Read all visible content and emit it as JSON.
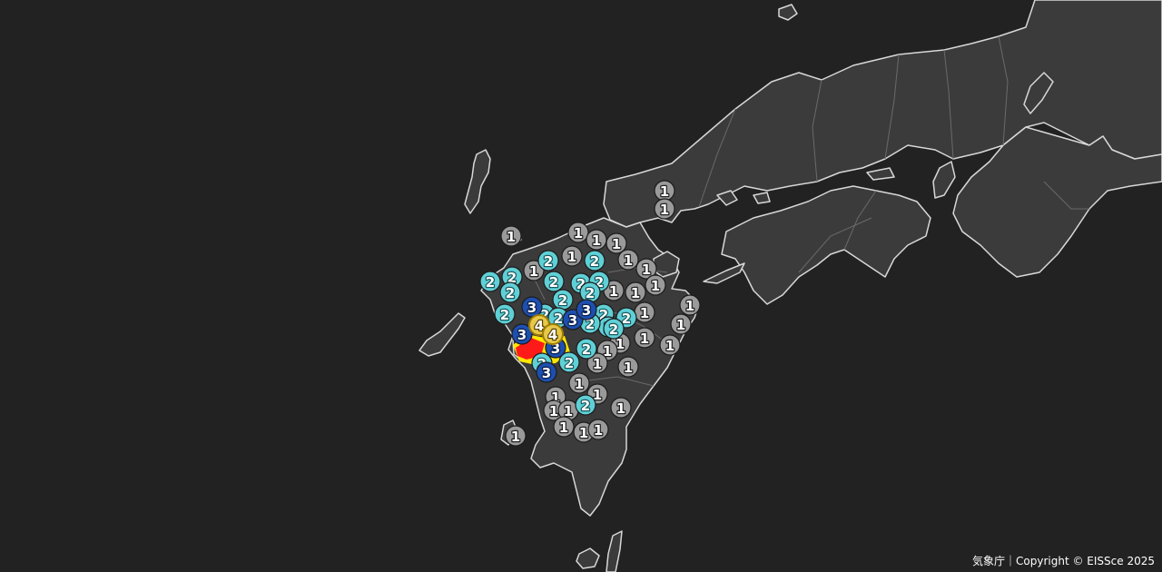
{
  "attribution": "気象庁｜Copyright © EISSce 2025",
  "colors": {
    "background": "#222222",
    "land": "#3b3b3b",
    "coast": "#d8d8d8",
    "borders": "#6a6a6a",
    "intensity": {
      "1": {
        "fill": "#9a9a9a",
        "text": "#ffffff",
        "stroke": "#222222"
      },
      "2": {
        "fill": "#5fd0d6",
        "text": "#ffffff",
        "stroke": "#1a5a5e"
      },
      "3": {
        "fill": "#1d4fb0",
        "text": "#ffffff",
        "stroke": "#0a1f4a"
      },
      "4": {
        "fill": "#e6c84a",
        "text": "#ffffff",
        "stroke": "#5a4400"
      }
    },
    "area_red": "#ff1a1a",
    "area_yellow": "#ffe600"
  },
  "map": {
    "type": "seismic-intensity-map",
    "region": "Kyushu",
    "legend": "none",
    "observations": [
      {
        "intensity": "1"
      },
      {
        "intensity": "1"
      },
      {
        "intensity": "1"
      },
      {
        "intensity": "1"
      },
      {
        "intensity": "1"
      },
      {
        "intensity": "1"
      },
      {
        "intensity": "1"
      },
      {
        "intensity": "1"
      },
      {
        "intensity": "1"
      },
      {
        "intensity": "1"
      },
      {
        "intensity": "1"
      },
      {
        "intensity": "1"
      },
      {
        "intensity": "1"
      },
      {
        "intensity": "1"
      },
      {
        "intensity": "1"
      },
      {
        "intensity": "1"
      },
      {
        "intensity": "1"
      },
      {
        "intensity": "1"
      },
      {
        "intensity": "1"
      },
      {
        "intensity": "1"
      },
      {
        "intensity": "1"
      },
      {
        "intensity": "1"
      },
      {
        "intensity": "1"
      },
      {
        "intensity": "1"
      },
      {
        "intensity": "1"
      },
      {
        "intensity": "1"
      },
      {
        "intensity": "1"
      },
      {
        "intensity": "1"
      },
      {
        "intensity": "1"
      },
      {
        "intensity": "1"
      },
      {
        "intensity": "1"
      },
      {
        "intensity": "1"
      },
      {
        "intensity": "2"
      },
      {
        "intensity": "2"
      },
      {
        "intensity": "2"
      },
      {
        "intensity": "2"
      },
      {
        "intensity": "2"
      },
      {
        "intensity": "2"
      },
      {
        "intensity": "2"
      },
      {
        "intensity": "2"
      },
      {
        "intensity": "2"
      },
      {
        "intensity": "2"
      },
      {
        "intensity": "2"
      },
      {
        "intensity": "2"
      },
      {
        "intensity": "2"
      },
      {
        "intensity": "2"
      },
      {
        "intensity": "2"
      },
      {
        "intensity": "2"
      },
      {
        "intensity": "2"
      },
      {
        "intensity": "2"
      },
      {
        "intensity": "2"
      },
      {
        "intensity": "2"
      },
      {
        "intensity": "2"
      },
      {
        "intensity": "2"
      },
      {
        "intensity": "3"
      },
      {
        "intensity": "3"
      },
      {
        "intensity": "3"
      },
      {
        "intensity": "3"
      },
      {
        "intensity": "3"
      },
      {
        "intensity": "3"
      },
      {
        "intensity": "4"
      },
      {
        "intensity": "4"
      }
    ]
  }
}
